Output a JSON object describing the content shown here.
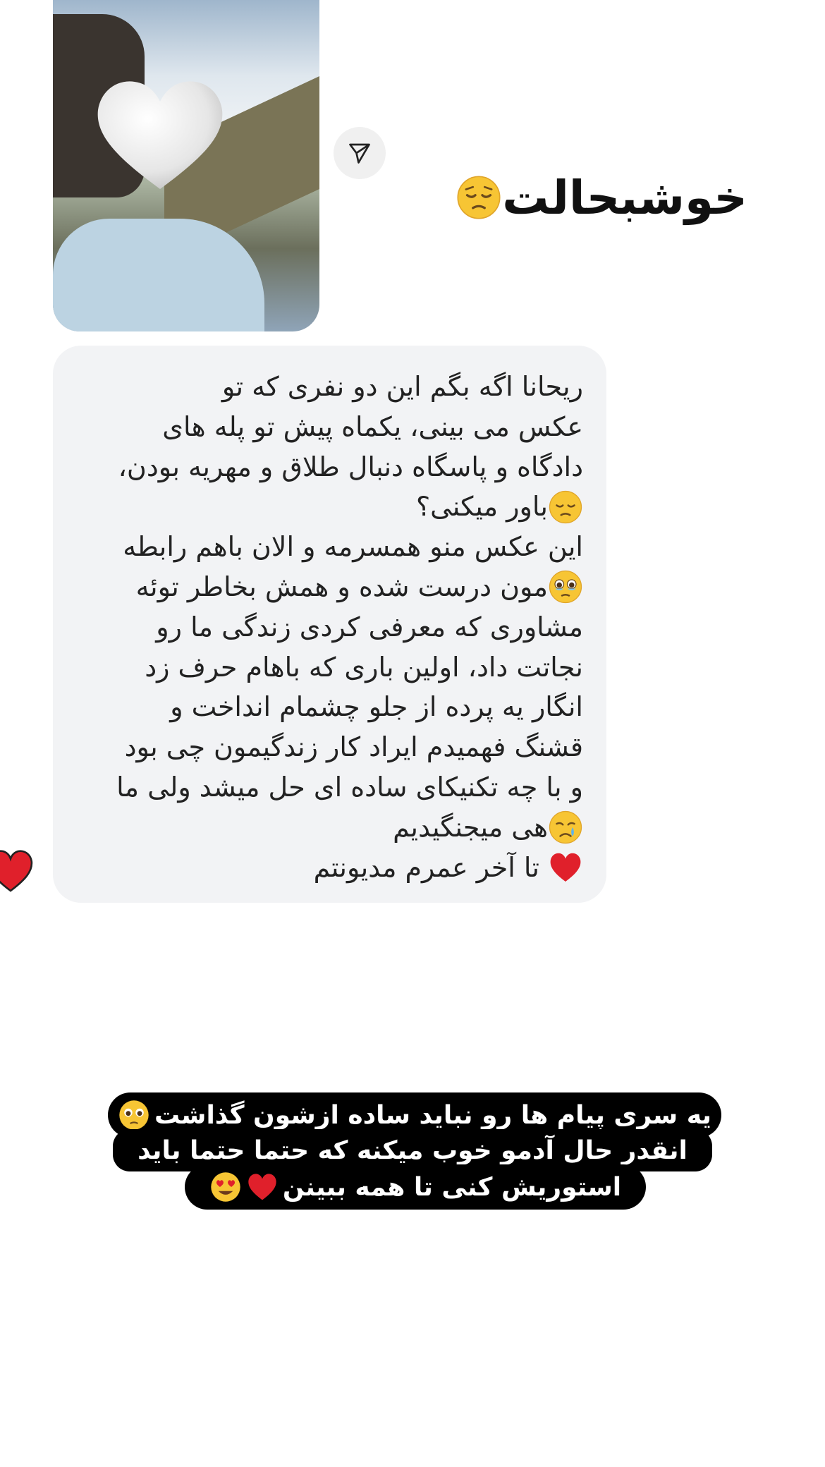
{
  "story": {
    "photo_alt": "couple photo with heart covering face",
    "send_icon": "paper-plane-icon"
  },
  "headline": {
    "text": "خوشبحالت",
    "emoji": "pensive-face"
  },
  "message": {
    "lines": [
      {
        "text": "ریحانا اگه بگم این دو نفری که تو",
        "emoji": null
      },
      {
        "text": "عکس می بینی، یکماه پیش تو پله های",
        "emoji": null
      },
      {
        "text": "دادگاه و پاسگاه دنبال طلاق و مهریه بودن،",
        "emoji": null
      },
      {
        "text": "باور میکنی؟",
        "emoji": "pensive-face"
      },
      {
        "text": "این عکس منو همسرمه و الان باهم رابطه",
        "emoji": null
      },
      {
        "text": "مون درست شده و همش بخاطر توئه",
        "emoji": "teary-face"
      },
      {
        "text": "مشاوری  که معرفی کردی زندگی ما رو",
        "emoji": null
      },
      {
        "text": "نجاتت داد، اولین باری که باهام حرف زد",
        "emoji": null
      },
      {
        "text": "انگار یه پرده از جلو چشمام انداخت و",
        "emoji": null
      },
      {
        "text": "قشنگ فهمیدم ایراد کار زندگیمون چی بود",
        "emoji": null
      },
      {
        "text": "و با چه تکنیکای ساده ای حل میشد ولی ما",
        "emoji": null
      },
      {
        "text": "هی میجنگیدیم",
        "emoji": "crying-face"
      },
      {
        "text": "تا آخر عمرم مدیونتم",
        "emoji": "red-heart"
      }
    ],
    "reaction": "red-heart"
  },
  "caption": {
    "line1": "یه سری پیام ها رو نباید ساده ازشون گذاشت",
    "line2": "انقدر حال آدمو خوب میکنه که حتما حتما باید",
    "line3": "استوریش کنی تا همه ببینن"
  },
  "colors": {
    "bubble_bg": "#f2f3f5",
    "caption_bg": "#000000",
    "heart_red": "#e0202b",
    "emoji_yellow": "#f7c534"
  }
}
